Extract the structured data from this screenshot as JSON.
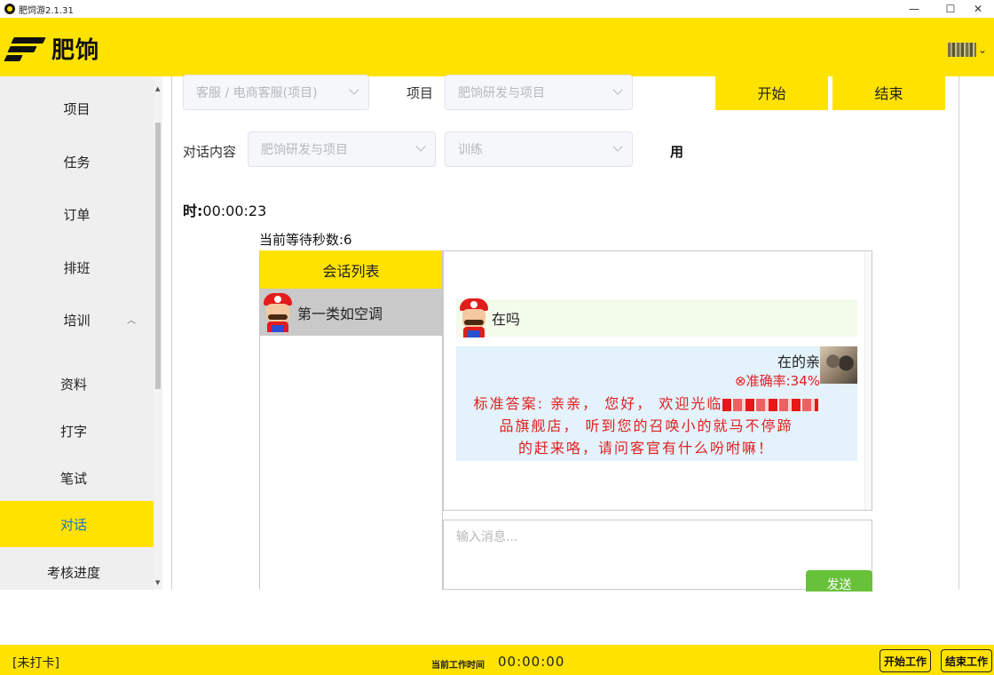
{
  "window": {
    "title": "肥饲游2.1.31",
    "minimize": "—",
    "maximize": "☐",
    "close": "✕"
  },
  "header": {
    "logo_text": "肥饷",
    "user_chevron": "⌄"
  },
  "sidebar": {
    "items": [
      {
        "label": "项目"
      },
      {
        "label": "任务"
      },
      {
        "label": "订单"
      },
      {
        "label": "排班"
      },
      {
        "label": "培训",
        "expanded": true
      },
      {
        "label": "资料"
      },
      {
        "label": "打字"
      },
      {
        "label": "笔试"
      },
      {
        "label": "对话",
        "active": true
      },
      {
        "label": "考核进度"
      }
    ],
    "scroll_up": "▲",
    "scroll_down": "▼"
  },
  "filters": {
    "category_value": "客服 / 电商客服(项目)",
    "project_label": "项目",
    "project_value": "肥饷研发与项目",
    "dialog_label": "对话内容",
    "dialog_value": "肥饷研发与项目",
    "mode_value": "训练",
    "side_text": "用"
  },
  "actions": {
    "start": "开始",
    "end": "结束"
  },
  "timer": {
    "label": "时:",
    "value": "00:00:23"
  },
  "wait_seconds": "当前等待秒数:6",
  "conversations": {
    "header": "会话列表",
    "items": [
      {
        "name": "第一类如空调"
      }
    ]
  },
  "messages": {
    "incoming": "在吗",
    "reply": "在的亲",
    "accuracy": "⊗准确率:34%",
    "standard_line1": "标准答案: 亲亲， 您好， 欢迎光临",
    "standard_line2": "品旗舰店， 听到您的召唤小的就马不停蹄",
    "standard_line3": "的赶来咯，请问客官有什么吩咐嘛！"
  },
  "composer": {
    "placeholder": "输入消息...",
    "send": "发送"
  },
  "bottom": {
    "punch_status": "[未打卡]",
    "work_time_label": "当前工作时间",
    "work_time_value": "00:00:00",
    "start_work": "开始工作",
    "end_work": "结束工作"
  },
  "colors": {
    "brand_yellow": "#ffe200",
    "active_text": "#1a73c8",
    "error_red": "#e02020",
    "send_green": "#67c23a"
  }
}
